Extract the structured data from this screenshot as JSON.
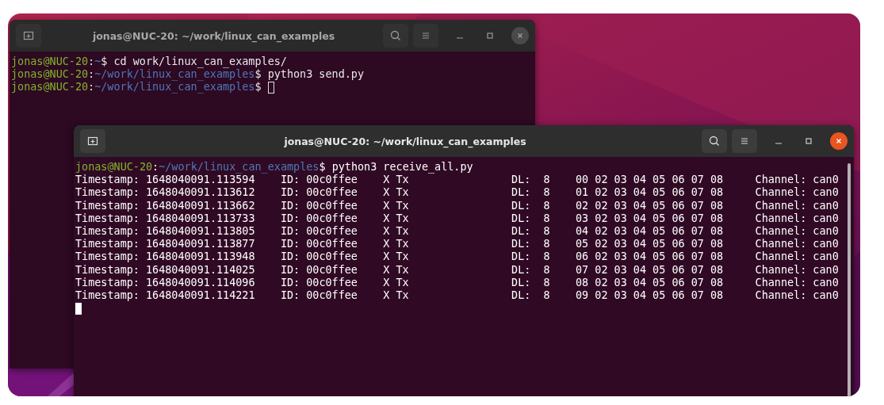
{
  "windows": [
    {
      "title": "jonas@NUC-20: ~/work/linux_can_examples",
      "active": false,
      "lines": [
        {
          "kind": "prompt",
          "user": "jonas@NUC-20",
          "separator": ":",
          "path": "~",
          "prompt_end": "$",
          "command": "cd work/linux_can_examples/"
        },
        {
          "kind": "prompt",
          "user": "jonas@NUC-20",
          "separator": ":",
          "path": "~/work/linux_can_examples",
          "prompt_end": "$",
          "command": "python3 send.py"
        },
        {
          "kind": "prompt",
          "user": "jonas@NUC-20",
          "separator": ":",
          "path": "~/work/linux_can_examples",
          "prompt_end": "$",
          "cursor": true
        }
      ]
    },
    {
      "title": "jonas@NUC-20: ~/work/linux_can_examples",
      "active": true,
      "lines": [
        {
          "kind": "prompt",
          "user": "jonas@NUC-20",
          "separator": ":",
          "path": "~/work/linux_can_examples",
          "prompt_end": "$",
          "command": "python3 receive_all.py"
        },
        {
          "kind": "output",
          "text": "Timestamp: 1648040091.113594    ID: 00c0ffee    X Tx                DL:  8    00 02 03 04 05 06 07 08     Channel: can0"
        },
        {
          "kind": "output",
          "text": "Timestamp: 1648040091.113612    ID: 00c0ffee    X Tx                DL:  8    01 02 03 04 05 06 07 08     Channel: can0"
        },
        {
          "kind": "output",
          "text": "Timestamp: 1648040091.113662    ID: 00c0ffee    X Tx                DL:  8    02 02 03 04 05 06 07 08     Channel: can0"
        },
        {
          "kind": "output",
          "text": "Timestamp: 1648040091.113733    ID: 00c0ffee    X Tx                DL:  8    03 02 03 04 05 06 07 08     Channel: can0"
        },
        {
          "kind": "output",
          "text": "Timestamp: 1648040091.113805    ID: 00c0ffee    X Tx                DL:  8    04 02 03 04 05 06 07 08     Channel: can0"
        },
        {
          "kind": "output",
          "text": "Timestamp: 1648040091.113877    ID: 00c0ffee    X Tx                DL:  8    05 02 03 04 05 06 07 08     Channel: can0"
        },
        {
          "kind": "output",
          "text": "Timestamp: 1648040091.113948    ID: 00c0ffee    X Tx                DL:  8    06 02 03 04 05 06 07 08     Channel: can0"
        },
        {
          "kind": "output",
          "text": "Timestamp: 1648040091.114025    ID: 00c0ffee    X Tx                DL:  8    07 02 03 04 05 06 07 08     Channel: can0"
        },
        {
          "kind": "output",
          "text": "Timestamp: 1648040091.114096    ID: 00c0ffee    X Tx                DL:  8    08 02 03 04 05 06 07 08     Channel: can0"
        },
        {
          "kind": "output",
          "text": "Timestamp: 1648040091.114221    ID: 00c0ffee    X Tx                DL:  8    09 02 03 04 05 06 07 08     Channel: can0"
        },
        {
          "kind": "cursor"
        }
      ]
    }
  ]
}
